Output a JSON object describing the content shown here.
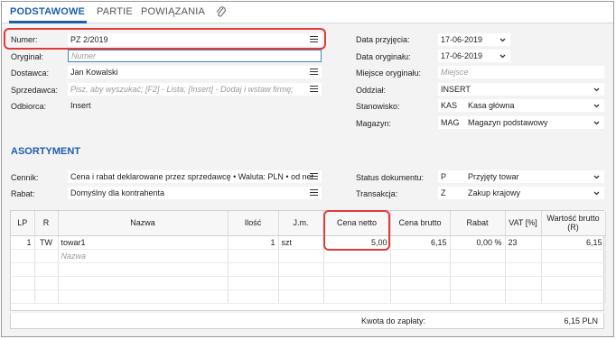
{
  "tabs": [
    "PODSTAWOWE",
    "PARTIE",
    "POWIĄZANIA"
  ],
  "left_form": {
    "numer": {
      "label": "Numer:",
      "value": "PZ 2/2019"
    },
    "oryginal": {
      "label": "Oryginał:",
      "placeholder": "Numer"
    },
    "dostawca": {
      "label": "Dostawca:",
      "value": "Jan Kowalski"
    },
    "sprzedawca": {
      "label": "Sprzedawca:",
      "placeholder": "Pisz, aby wyszukać; [F2] - Lista; [Insert] - Dodaj i wstaw firmę;"
    },
    "odbiorca": {
      "label": "Odbiorca:",
      "value": "Insert"
    }
  },
  "right_form": {
    "data_przyjecia": {
      "label": "Data przyjęcia:",
      "value": "17-06-2019"
    },
    "data_oryginalu": {
      "label": "Data oryginału:",
      "value": "17-06-2019"
    },
    "miejsce_oryginalu": {
      "label": "Miejsce oryginału:",
      "placeholder": "Miejsce"
    },
    "oddzial": {
      "label": "Oddział:",
      "value": "INSERT"
    },
    "stanowisko": {
      "label": "Stanowisko:",
      "code": "KAS",
      "value": "Kasa główna"
    },
    "magazyn": {
      "label": "Magazyn:",
      "code": "MAG",
      "value": "Magazyn podstawowy"
    }
  },
  "asortyment": {
    "title": "ASORTYMENT",
    "cennik": {
      "label": "Cennik:",
      "value": "Cena i rabat deklarowane przez sprzedawcę • Waluta: PLN • od net"
    },
    "rabat": {
      "label": "Rabat:",
      "value": "Domyślny dla kontrahenta"
    },
    "status": {
      "label": "Status dokumentu:",
      "code": "P",
      "value": "Przyjęty towar"
    },
    "transakcja": {
      "label": "Transakcja:",
      "code": "Z",
      "value": "Zakup krajowy"
    }
  },
  "grid": {
    "headers": [
      "LP",
      "R",
      "Nazwa",
      "Ilość",
      "J.m.",
      "Cena netto",
      "Cena brutto",
      "Rabat",
      "VAT [%]",
      "Wartość brutto (R)"
    ],
    "rows": [
      {
        "lp": "1",
        "r": "TW",
        "nazwa": "towar1",
        "ilosc": "1",
        "jm": "szt",
        "cena_netto": "5,00",
        "cena_brutto": "6,15",
        "rabat": "0,00 %",
        "vat": "23",
        "wartosc": "6,15"
      }
    ],
    "new_row_placeholder": "Nazwa"
  },
  "footer": {
    "label": "Kwota do zapłaty:",
    "value": "6,15 PLN"
  },
  "colors": {
    "accent": "#1f5fa8",
    "highlight": "#e03a3a"
  }
}
